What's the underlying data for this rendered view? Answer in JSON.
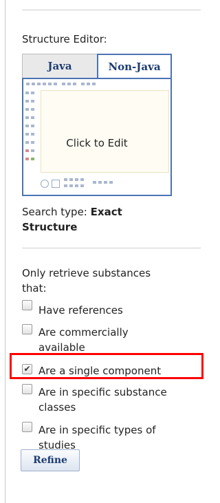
{
  "structure_editor": {
    "heading": "Structure Editor:",
    "tabs": [
      {
        "label": "Java",
        "active": false
      },
      {
        "label": "Non-Java",
        "active": true
      }
    ],
    "placeholder": "Click to Edit"
  },
  "search_type": {
    "label": "Search type:",
    "value_line1": "Exact",
    "value_line2": "Structure"
  },
  "filters": {
    "intro_line1": "Only retrieve substances",
    "intro_line2": "that:",
    "options": [
      {
        "lines": [
          "Have references"
        ],
        "checked": false
      },
      {
        "lines": [
          "Are commercially",
          "available"
        ],
        "checked": false
      },
      {
        "lines": [
          "Are a single component"
        ],
        "checked": true,
        "highlighted": true
      },
      {
        "lines": [
          "Are in specific substance",
          "classes"
        ],
        "checked": false
      },
      {
        "lines": [
          "Are in specific types of",
          "studies"
        ],
        "checked": false
      }
    ]
  },
  "refine_label": "Refine",
  "colors": {
    "tab_border": "#4a73b3",
    "tab_text": "#1c3c72",
    "highlight": "#ff0000"
  }
}
